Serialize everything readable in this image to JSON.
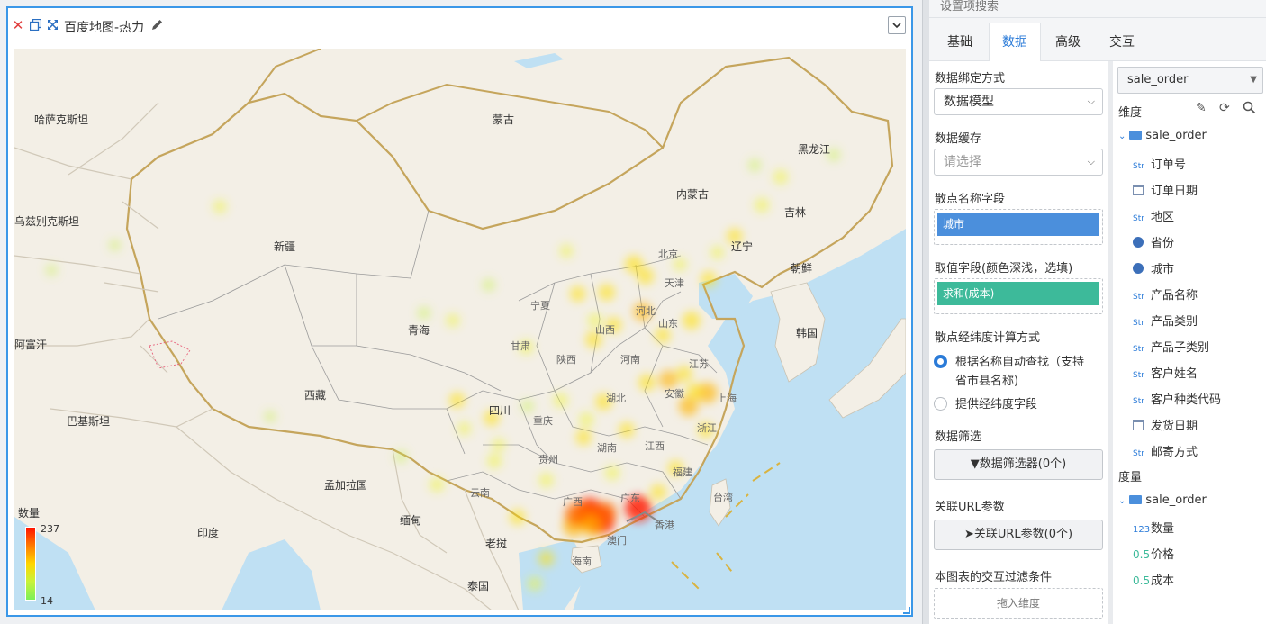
{
  "widget": {
    "title": "百度地图-热力",
    "legend": {
      "title": "数量",
      "max": "237",
      "min": "14"
    }
  },
  "map": {
    "labels": [
      {
        "name": "哈萨克斯坦"
      },
      {
        "name": "蒙古"
      },
      {
        "name": "黑龙江"
      },
      {
        "name": "内蒙古"
      },
      {
        "name": "吉林"
      },
      {
        "name": "乌兹别克斯坦"
      },
      {
        "name": "新疆"
      },
      {
        "name": "辽宁"
      },
      {
        "name": "北京"
      },
      {
        "name": "朝鲜"
      },
      {
        "name": "天津"
      },
      {
        "name": "宁夏"
      },
      {
        "name": "河北"
      },
      {
        "name": "山东"
      },
      {
        "name": "青海"
      },
      {
        "name": "山西"
      },
      {
        "name": "韩国"
      },
      {
        "name": "阿富汗"
      },
      {
        "name": "甘肃"
      },
      {
        "name": "陕西"
      },
      {
        "name": "河南"
      },
      {
        "name": "江苏"
      },
      {
        "name": "西藏"
      },
      {
        "name": "湖北"
      },
      {
        "name": "安徽"
      },
      {
        "name": "上海"
      },
      {
        "name": "四川"
      },
      {
        "name": "重庆"
      },
      {
        "name": "浙江"
      },
      {
        "name": "巴基斯坦"
      },
      {
        "name": "湖南"
      },
      {
        "name": "江西"
      },
      {
        "name": "贵州"
      },
      {
        "name": "福建"
      },
      {
        "name": "孟加拉国"
      },
      {
        "name": "云南"
      },
      {
        "name": "台湾"
      },
      {
        "name": "广西"
      },
      {
        "name": "广东"
      },
      {
        "name": "缅甸"
      },
      {
        "name": "香港"
      },
      {
        "name": "印度"
      },
      {
        "name": "老挝"
      },
      {
        "name": "澳门"
      },
      {
        "name": "海南"
      },
      {
        "name": "泰国"
      }
    ],
    "water_color": "#bfe0f3",
    "land_color": "#f3efe6"
  },
  "panel": {
    "search_placeholder": "设置项搜索",
    "tabs": [
      "基础",
      "数据",
      "高级",
      "交互"
    ],
    "active_tab": "数据",
    "settings": {
      "binding_label": "数据绑定方式",
      "binding_value": "数据模型",
      "cache_label": "数据缓存",
      "cache_placeholder": "请选择",
      "scatter_name_label": "散点名称字段",
      "scatter_name_chip": "城市",
      "value_label": "取值字段(颜色深浅，选填)",
      "value_chip": "求和(成本)",
      "calc_label": "散点经纬度计算方式",
      "radio_auto": "根据名称自动查找（支持",
      "radio_auto_2": "省市县名称)",
      "radio_manual": "提供经纬度字段",
      "filter_label": "数据筛选",
      "filter_button": "数据筛选器(0个)",
      "url_label": "关联URL参数",
      "url_button": "关联URL参数(0个)",
      "interaction_label": "本图表的交互过滤条件",
      "drop_hint": "拖入维度"
    },
    "fields": {
      "model": "sale_order",
      "dimension_title": "维度",
      "dimension_root": "sale_order",
      "dimensions": [
        {
          "type": "Str",
          "name": "订单号"
        },
        {
          "type": "date",
          "name": "订单日期"
        },
        {
          "type": "Str",
          "name": "地区"
        },
        {
          "type": "geo",
          "name": "省份"
        },
        {
          "type": "geo",
          "name": "城市"
        },
        {
          "type": "Str",
          "name": "产品名称"
        },
        {
          "type": "Str",
          "name": "产品类别"
        },
        {
          "type": "Str",
          "name": "产品子类别"
        },
        {
          "type": "Str",
          "name": "客户姓名"
        },
        {
          "type": "Str",
          "name": "客户种类代码"
        },
        {
          "type": "date",
          "name": "发货日期"
        },
        {
          "type": "Str",
          "name": "邮寄方式"
        }
      ],
      "measure_title": "度量",
      "measure_root": "sale_order",
      "measures": [
        {
          "type": "123",
          "name": "数量"
        },
        {
          "type": "0.5",
          "name": "价格"
        },
        {
          "type": "0.5",
          "name": "成本"
        }
      ]
    }
  },
  "heat_points": [
    {
      "lon": 113.3,
      "lat": 23.1,
      "w": 1.0
    },
    {
      "lon": 114.1,
      "lat": 22.6,
      "w": 0.95
    },
    {
      "lon": 116.7,
      "lat": 23.4,
      "w": 0.85
    },
    {
      "lon": 113.1,
      "lat": 22.9,
      "w": 0.8
    },
    {
      "lon": 112.2,
      "lat": 22.2,
      "w": 0.6
    },
    {
      "lon": 121.5,
      "lat": 31.2,
      "w": 0.55
    },
    {
      "lon": 120.2,
      "lat": 30.3,
      "w": 0.5
    },
    {
      "lon": 118.8,
      "lat": 32.1,
      "w": 0.45
    },
    {
      "lon": 117.0,
      "lat": 36.7,
      "w": 0.45
    },
    {
      "lon": 120.4,
      "lat": 36.1,
      "w": 0.4
    },
    {
      "lon": 113.6,
      "lat": 34.8,
      "w": 0.35
    },
    {
      "lon": 114.3,
      "lat": 30.6,
      "w": 0.35
    },
    {
      "lon": 116.4,
      "lat": 39.9,
      "w": 0.4
    },
    {
      "lon": 117.2,
      "lat": 39.1,
      "w": 0.35
    },
    {
      "lon": 114.5,
      "lat": 38.0,
      "w": 0.35
    },
    {
      "lon": 112.5,
      "lat": 37.9,
      "w": 0.3
    },
    {
      "lon": 106.5,
      "lat": 29.5,
      "w": 0.3
    },
    {
      "lon": 104.1,
      "lat": 30.7,
      "w": 0.3
    },
    {
      "lon": 108.9,
      "lat": 34.3,
      "w": 0.25
    },
    {
      "lon": 112.9,
      "lat": 28.2,
      "w": 0.3
    },
    {
      "lon": 115.9,
      "lat": 28.7,
      "w": 0.3
    },
    {
      "lon": 119.3,
      "lat": 26.1,
      "w": 0.3
    },
    {
      "lon": 118.1,
      "lat": 24.5,
      "w": 0.3
    },
    {
      "lon": 110.3,
      "lat": 20.0,
      "w": 0.3
    },
    {
      "lon": 109.5,
      "lat": 18.3,
      "w": 0.25
    },
    {
      "lon": 108.3,
      "lat": 22.8,
      "w": 0.3
    },
    {
      "lon": 102.7,
      "lat": 25.0,
      "w": 0.25
    },
    {
      "lon": 106.7,
      "lat": 26.6,
      "w": 0.25
    },
    {
      "lon": 117.3,
      "lat": 31.9,
      "w": 0.35
    },
    {
      "lon": 123.4,
      "lat": 41.8,
      "w": 0.3
    },
    {
      "lon": 121.6,
      "lat": 38.9,
      "w": 0.3
    },
    {
      "lon": 125.3,
      "lat": 43.9,
      "w": 0.25
    },
    {
      "lon": 126.6,
      "lat": 45.8,
      "w": 0.25
    },
    {
      "lon": 111.7,
      "lat": 40.8,
      "w": 0.2
    },
    {
      "lon": 103.8,
      "lat": 36.1,
      "w": 0.2
    },
    {
      "lon": 87.6,
      "lat": 43.8,
      "w": 0.2
    },
    {
      "lon": 101.8,
      "lat": 36.6,
      "w": 0.15
    },
    {
      "lon": 106.3,
      "lat": 38.5,
      "w": 0.15
    },
    {
      "lon": 119.9,
      "lat": 32.5,
      "w": 0.3
    },
    {
      "lon": 120.6,
      "lat": 31.3,
      "w": 0.35
    },
    {
      "lon": 121.4,
      "lat": 28.7,
      "w": 0.3
    },
    {
      "lon": 115.0,
      "lat": 35.8,
      "w": 0.3
    },
    {
      "lon": 118.4,
      "lat": 35.1,
      "w": 0.3
    },
    {
      "lon": 113.7,
      "lat": 36.1,
      "w": 0.25
    },
    {
      "lon": 111.3,
      "lat": 30.7,
      "w": 0.25
    },
    {
      "lon": 114.9,
      "lat": 25.8,
      "w": 0.25
    },
    {
      "lon": 110.3,
      "lat": 25.3,
      "w": 0.25
    },
    {
      "lon": 113.1,
      "lat": 29.4,
      "w": 0.25
    },
    {
      "lon": 130.3,
      "lat": 47.3,
      "w": 0.15
    },
    {
      "lon": 124.8,
      "lat": 46.6,
      "w": 0.15
    },
    {
      "lon": 122.2,
      "lat": 40.7,
      "w": 0.2
    },
    {
      "lon": 119.6,
      "lat": 39.9,
      "w": 0.2
    },
    {
      "lon": 80.3,
      "lat": 41.2,
      "w": 0.1
    },
    {
      "lon": 75.9,
      "lat": 39.5,
      "w": 0.1
    },
    {
      "lon": 91.1,
      "lat": 29.6,
      "w": 0.1
    },
    {
      "lon": 104.6,
      "lat": 28.8,
      "w": 0.2
    },
    {
      "lon": 109.0,
      "lat": 30.3,
      "w": 0.15
    },
    {
      "lon": 100.2,
      "lat": 26.9,
      "w": 0.15
    },
    {
      "lon": 107.0,
      "lat": 27.7,
      "w": 0.2
    },
    {
      "lon": 112.4,
      "lat": 23.0,
      "w": 0.7
    },
    {
      "lon": 113.5,
      "lat": 22.2,
      "w": 0.6
    },
    {
      "lon": 114.4,
      "lat": 23.1,
      "w": 0.65
    }
  ]
}
